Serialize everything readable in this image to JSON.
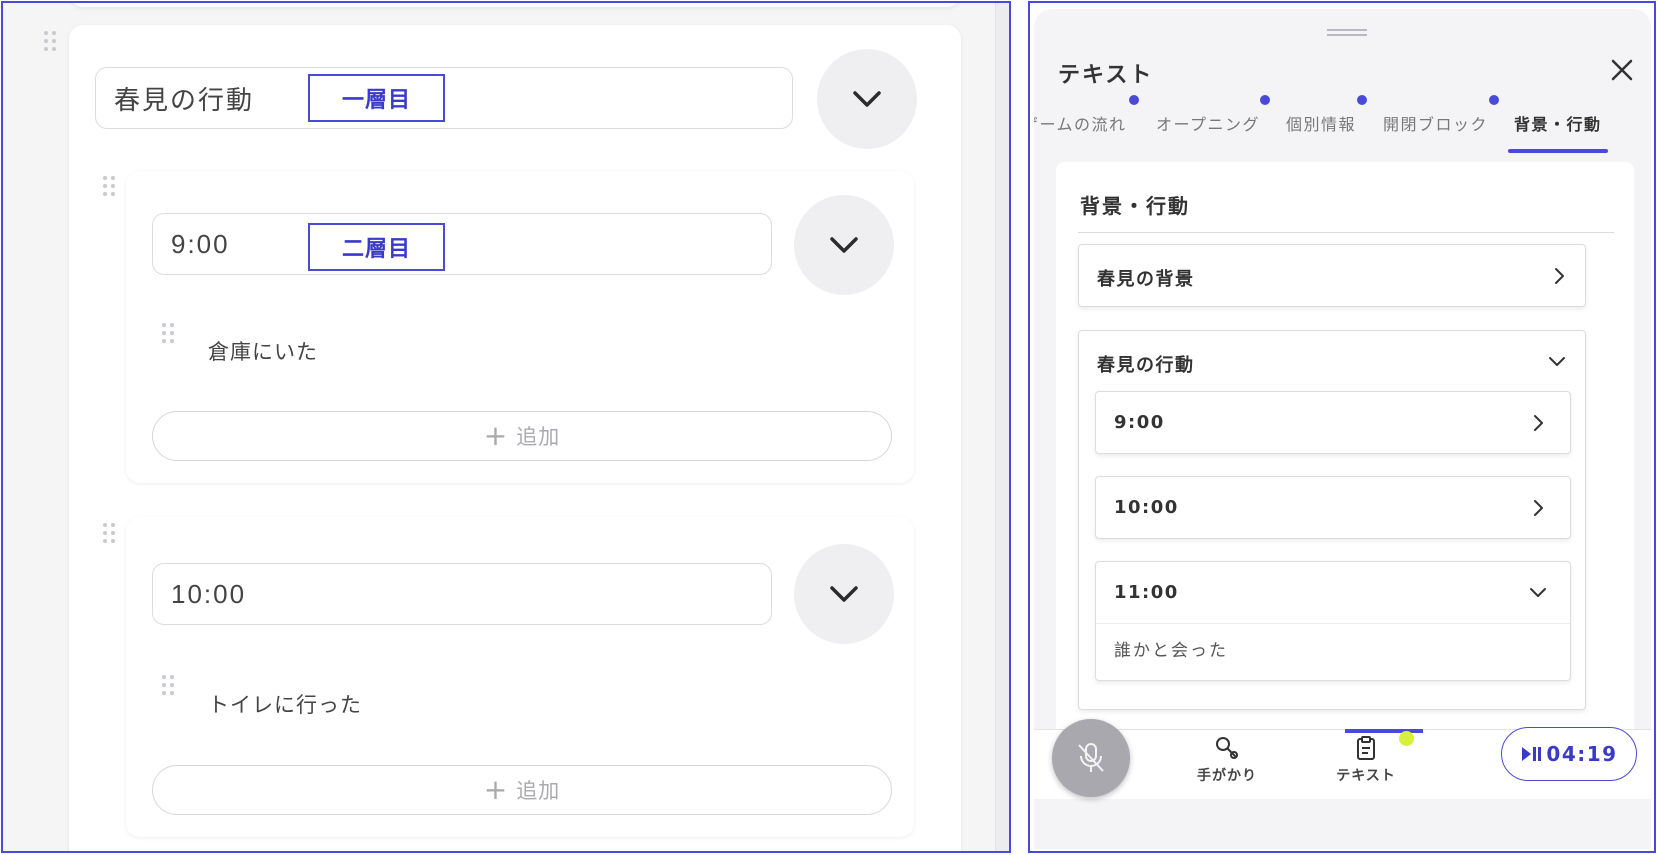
{
  "left": {
    "outer_field": {
      "value": "春見の行動",
      "tag": "一層目"
    },
    "group1": {
      "field": {
        "value": "9:00",
        "tag": "二層目"
      },
      "item": "倉庫にいた",
      "add_label": "追加",
      "add_icon": "plus-icon"
    },
    "group2": {
      "field": {
        "value": "10:00"
      },
      "item": "トイレに行った",
      "add_label": "追加",
      "add_icon": "plus-icon"
    }
  },
  "right": {
    "title": "テキスト",
    "tabs": [
      {
        "label": "ゲームの流れ",
        "active": false,
        "dot": true
      },
      {
        "label": "オープニング",
        "active": false,
        "dot": true
      },
      {
        "label": "個別情報",
        "active": false,
        "dot": true
      },
      {
        "label": "開閉ブロック",
        "active": false,
        "dot": true
      },
      {
        "label": "背景・行動",
        "active": true,
        "dot": false
      }
    ],
    "section_title": "背景・行動",
    "accordions": [
      {
        "label": "春見の背景",
        "expanded": false
      },
      {
        "label": "春見の行動",
        "expanded": true,
        "children": [
          {
            "label": "9:00",
            "expanded": false
          },
          {
            "label": "10:00",
            "expanded": false
          },
          {
            "label": "11:00",
            "expanded": true,
            "body": "誰かと会った"
          }
        ]
      }
    ],
    "bottom_nav": {
      "mic_icon": "mic-off-icon",
      "items": [
        {
          "label": "手がかり",
          "icon": "search-key-icon",
          "active": false
        },
        {
          "label": "テキスト",
          "icon": "clipboard-icon",
          "active": true
        }
      ],
      "timer": "04:19",
      "timer_icon": "play-pause-icon"
    },
    "colors": {
      "accent": "#4a4ad8",
      "notification": "#d7f03c",
      "mic_disabled": "#a8a8ae"
    }
  }
}
